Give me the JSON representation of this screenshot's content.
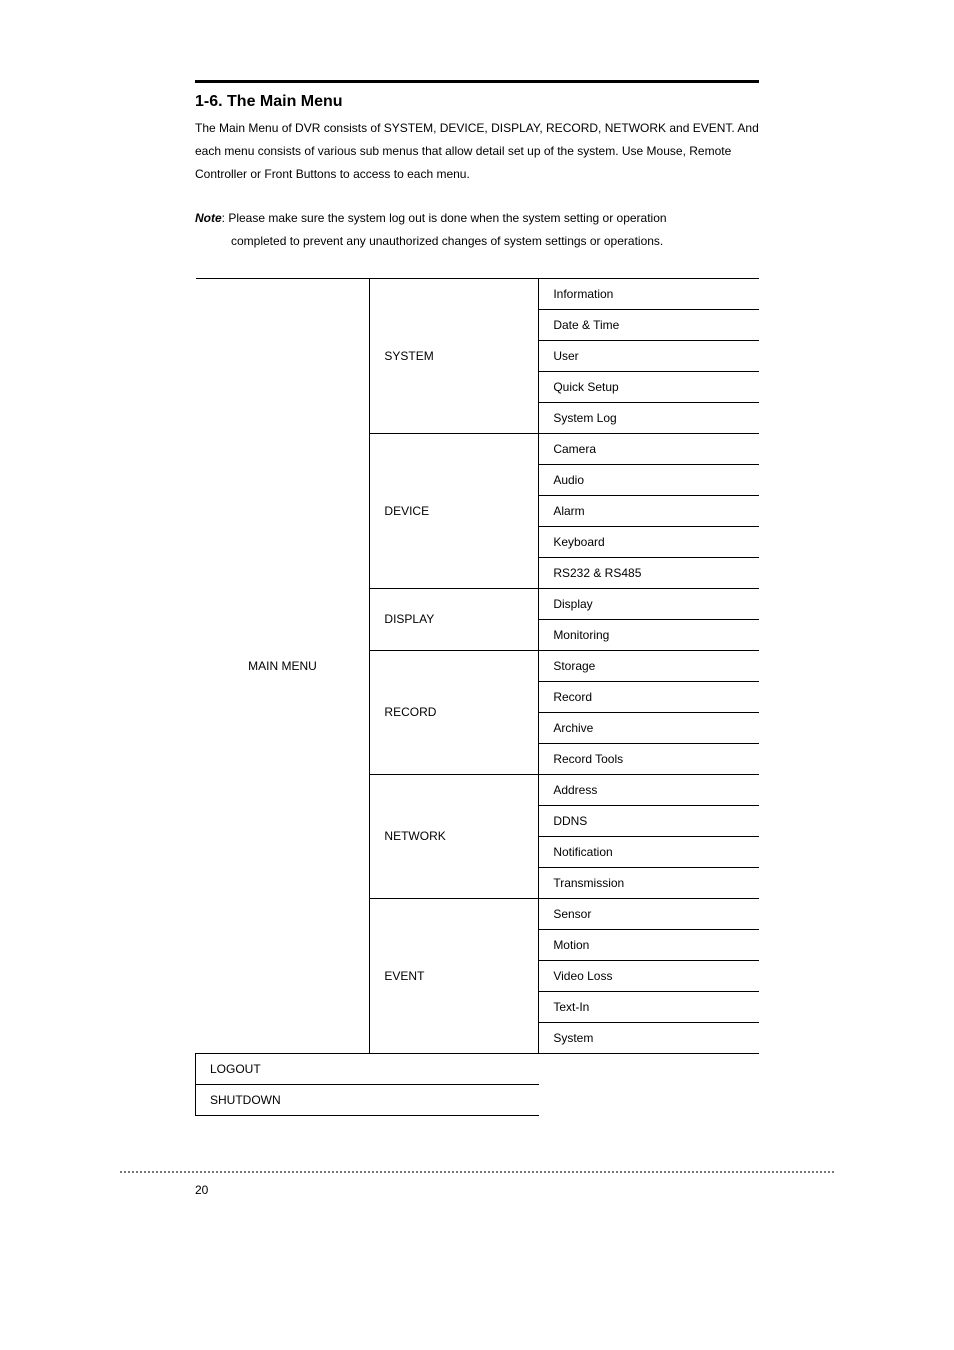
{
  "heading": "1-6. The Main Menu",
  "intro": "The Main Menu of DVR consists of SYSTEM, DEVICE, DISPLAY, RECORD, NETWORK and EVENT. And each menu consists of various sub menus that allow detail set up of the system. Use Mouse, Remote Controller or Front Buttons to access to each menu.",
  "note_label": "Note",
  "note_line1": ": Please make sure the system log out is done when the system setting or operation",
  "note_line2": "completed to prevent any unauthorized changes of system settings or operations.",
  "main_label": "MAIN MENU",
  "cats": {
    "system": "SYSTEM",
    "device": "DEVICE",
    "display": "DISPLAY",
    "record": "RECORD",
    "network": "NETWORK",
    "event": "EVENT",
    "logout": "LOGOUT",
    "shutdown": "SHUTDOWN"
  },
  "subs": {
    "information": "Information",
    "datetime": "Date & Time",
    "user": "User",
    "quicksetup": "Quick Setup",
    "systemlog": "System Log",
    "camera": "Camera",
    "audio": "Audio",
    "alarm": "Alarm",
    "keyboard": "Keyboard",
    "rs": "RS232 & RS485",
    "disp": "Display",
    "monitoring": "Monitoring",
    "storage": "Storage",
    "rec": "Record",
    "archive": "Archive",
    "rectools": "Record Tools",
    "address": "Address",
    "ddns": "DDNS",
    "notification": "Notification",
    "transmission": "Transmission",
    "sensor": "Sensor",
    "motion": "Motion",
    "videoloss": "Video Loss",
    "textin": "Text-In",
    "system_e": "System"
  },
  "page_number": "20"
}
